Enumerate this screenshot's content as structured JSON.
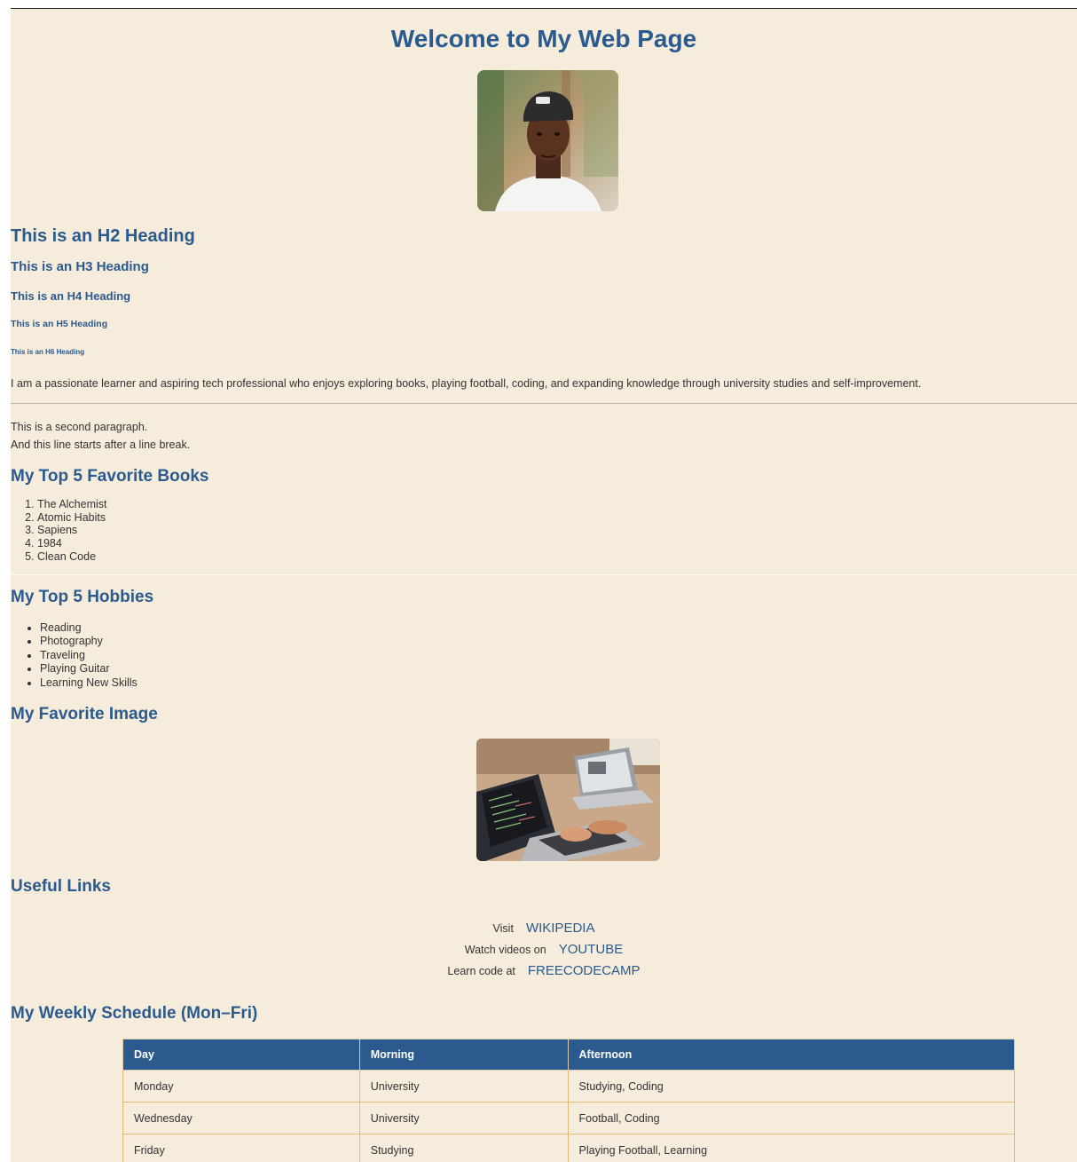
{
  "header": {
    "title": "Welcome to My Web Page"
  },
  "headings": {
    "h2": "This is an H2 Heading",
    "h3": "This is an H3 Heading",
    "h4": "This is an H4 Heading",
    "h5": "This is an H5 Heading",
    "h6": "This is an H6 Heading"
  },
  "intro": "I am a passionate learner and aspiring tech professional who enjoys exploring books, playing football, coding, and expanding knowledge through university studies and self-improvement.",
  "second": {
    "line1": "This is a second paragraph.",
    "line2": "And this line starts after a line break."
  },
  "books": {
    "title": "My Top 5 Favorite Books",
    "items": [
      "The Alchemist",
      "Atomic Habits",
      "Sapiens",
      "1984",
      "Clean Code"
    ]
  },
  "hobbies": {
    "title": "My Top 5 Hobbies",
    "items": [
      "Reading",
      "Photography",
      "Traveling",
      "Playing Guitar",
      "Learning New Skills"
    ]
  },
  "favorite_image": {
    "title": "My Favorite Image"
  },
  "links": {
    "title": "Useful Links",
    "items": [
      {
        "prefix": "Visit",
        "label": "WIKIPEDIA"
      },
      {
        "prefix": "Watch videos on",
        "label": "YOUTUBE"
      },
      {
        "prefix": "Learn code at",
        "label": "FREECODECAMP"
      }
    ]
  },
  "schedule": {
    "title": "My Weekly Schedule (Mon–Fri)",
    "headers": [
      "Day",
      "Morning",
      "Afternoon"
    ],
    "rows": [
      [
        "Monday",
        "University",
        "Studying, Coding"
      ],
      [
        "Wednesday",
        "University",
        "Football, Coding"
      ],
      [
        "Friday",
        "Studying",
        "Playing Football, Learning"
      ]
    ]
  },
  "colors": {
    "page_background": "#f5ecdc",
    "heading": "#2b5a8e",
    "table_header": "#2b5a8e",
    "table_border": "#e8b878"
  }
}
